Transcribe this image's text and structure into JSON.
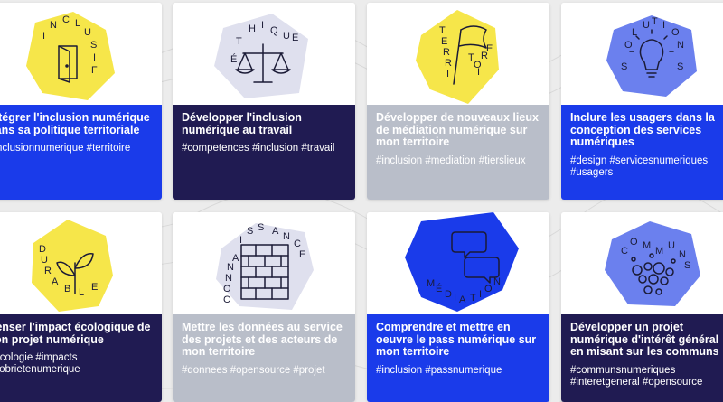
{
  "palette": {
    "blue": "#1a3bea",
    "navy": "#201b52",
    "grey": "#b9bec9",
    "yellow": "#f6e64a",
    "lavender": "#dfe0ee",
    "periwinkle": "#6b80ee"
  },
  "cards": [
    {
      "title": "Intégrer l'inclusion numérique dans sa politique territoriale",
      "tags": "#inclusionnumerique #territoire",
      "illustration": {
        "word_letters": [
          "I",
          "N",
          "C",
          "L",
          "U",
          "S",
          "I",
          "F"
        ],
        "icon": "door-icon"
      }
    },
    {
      "title": "Développer l'inclusion numérique au travail",
      "tags": "#competences #inclusion #travail",
      "illustration": {
        "word_letters": [
          "É",
          "T",
          "H",
          "I",
          "Q",
          "U",
          "E"
        ],
        "icon": "scales-icon"
      }
    },
    {
      "title": "Développer de nouveaux lieux de médiation numérique sur mon territoire",
      "tags": "#inclusion #mediation #tierslieux",
      "illustration": {
        "word_letters": [
          "T",
          "E",
          "R",
          "R",
          "I",
          "T",
          "O",
          "I",
          "R",
          "E"
        ],
        "icon": "flag-icon"
      }
    },
    {
      "title": "Inclure les usagers dans la conception des services numériques",
      "tags": "#design #servicesnumeriques #usagers",
      "illustration": {
        "word_letters": [
          "S",
          "O",
          "L",
          "U",
          "T",
          "I",
          "O",
          "N",
          "S"
        ],
        "icon": "lightbulb-icon"
      }
    },
    {
      "title": "Penser l'impact écologique de son projet numérique",
      "tags": "#ecologie #impacts #sobrietenumerique",
      "illustration": {
        "word_letters": [
          "D",
          "U",
          "R",
          "A",
          "B",
          "L",
          "E"
        ],
        "icon": "plant-icon"
      }
    },
    {
      "title": "Mettre les données au service des projets et des acteurs de mon territoire",
      "tags": "#donnees #opensource #projet",
      "illustration": {
        "word_letters": [
          "C",
          "O",
          "N",
          "N",
          "A",
          "I",
          "S",
          "S",
          "A",
          "N",
          "C",
          "E"
        ],
        "icon": "brick-wall-icon"
      }
    },
    {
      "title": "Comprendre et mettre en oeuvre le pass numérique sur mon territoire",
      "tags": "#inclusion #passnumerique",
      "illustration": {
        "word_letters": [
          "M",
          "É",
          "D",
          "I",
          "A",
          "T",
          "I",
          "O",
          "N"
        ],
        "icon": "speech-bubbles-icon"
      }
    },
    {
      "title": "Développer un projet numérique d'intérêt général en misant sur les communs",
      "tags": "#communsnumeriques #interetgeneral #opensource",
      "illustration": {
        "word_letters": [
          "C",
          "O",
          "M",
          "M",
          "U",
          "N",
          "S"
        ],
        "icon": "bubbles-cluster-icon"
      }
    }
  ]
}
